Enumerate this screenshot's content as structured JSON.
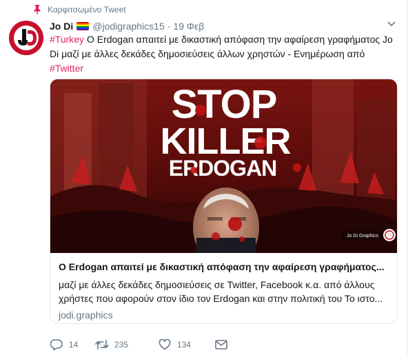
{
  "pinned": {
    "label": "Καρφιτσωμένο Tweet",
    "icon": "pin-icon"
  },
  "author": {
    "name": "Jo Di",
    "handle": "@jodigraphics15",
    "separator": "·",
    "date": "19 Φεβ",
    "avatar_text": "JD",
    "flag_icon": "rainbow-flag-icon"
  },
  "tweet": {
    "hashtag1": "#Turkey",
    "body": " Ο Erdogan απαιτεί με δικαστική απόφαση την αφαίρεση γραφήματος Jo Di μαζί με άλλες δεκάδες δημοσιεύσεις άλλων χρηστών - Ενημέρωση από ",
    "hashtag2": "#Twitter"
  },
  "card": {
    "image_line1": "STOP",
    "image_line2": "KILLER",
    "image_line3": "ERDOGAN",
    "image_watermark": "Jo Di Graphics",
    "title": "Ο Erdogan απαιτεί με δικαστική απόφαση την αφαίρεση γραφήματος...",
    "description": "μαζί με άλλες δεκάδες δημοσιεύσεις σε Twitter, Facebook κ.α. από άλλους χρήστες που αφορούν στον ίδιο τον Erdogan και στην πολιτική του Το ιστο...",
    "domain": "jodi.graphics"
  },
  "actions": {
    "reply_count": "14",
    "retweet_count": "235",
    "like_count": "134"
  },
  "colors": {
    "hashtag": "#e0245e",
    "secondary_text": "#657786",
    "border": "#e1e8ed"
  }
}
